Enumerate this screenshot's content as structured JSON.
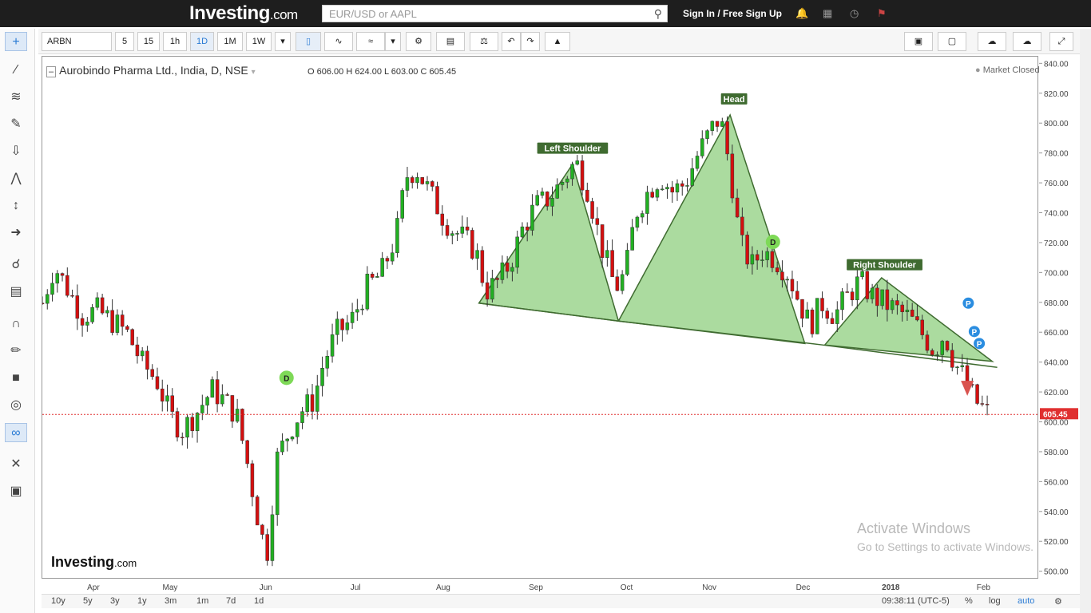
{
  "header": {
    "logo_main": "Investing",
    "logo_suffix": ".com",
    "search_placeholder": "EUR/USD or AAPL",
    "signin": "Sign In / Free Sign Up"
  },
  "toolbar": {
    "symbol": "ARBN",
    "intervals": [
      "5",
      "15",
      "1h",
      "1D",
      "1M",
      "1W"
    ],
    "active_interval": "1D"
  },
  "legend": {
    "title": "Aurobindo Pharma Ltd., India, D, NSE",
    "ohlc": "O 606.00  H 624.00  L 603.00  C 605.45",
    "market_status": "Market Closed"
  },
  "bottombar": {
    "ranges": [
      "10y",
      "5y",
      "3y",
      "1y",
      "3m",
      "1m",
      "7d",
      "1d"
    ],
    "time": "09:38:11 (UTC-5)",
    "percent": "%",
    "log": "log",
    "auto": "auto"
  },
  "watermark": {
    "main": "Investing",
    "suffix": ".com"
  },
  "os_notice": {
    "line1": "Activate Windows",
    "line2": "Go to Settings to activate Windows."
  },
  "colors": {
    "up": "#22b022",
    "down": "#d40f0f",
    "pattern_fill": "#8fcf7f",
    "pattern_line": "#3f6b30",
    "price_line": "#e03030",
    "accent": "#2a7bd4"
  },
  "chart_data": {
    "type": "candlestick",
    "ylim": [
      495,
      845
    ],
    "y_ticks": [
      500,
      520,
      540,
      560,
      580,
      600,
      620,
      640,
      660,
      680,
      700,
      720,
      740,
      760,
      780,
      800,
      820,
      840
    ],
    "x_ticks": [
      {
        "label": "Apr",
        "t": 0.052
      },
      {
        "label": "May",
        "t": 0.129
      },
      {
        "label": "Jun",
        "t": 0.225
      },
      {
        "label": "Jul",
        "t": 0.315
      },
      {
        "label": "Aug",
        "t": 0.403
      },
      {
        "label": "Sep",
        "t": 0.496
      },
      {
        "label": "Oct",
        "t": 0.587
      },
      {
        "label": "Nov",
        "t": 0.67
      },
      {
        "label": "Dec",
        "t": 0.764
      },
      {
        "label": "2018",
        "t": 0.852
      },
      {
        "label": "Feb",
        "t": 0.945
      }
    ],
    "close_series": [
      [
        0.0,
        680
      ],
      [
        0.012,
        705
      ],
      [
        0.025,
        690
      ],
      [
        0.04,
        672
      ],
      [
        0.055,
        675
      ],
      [
        0.07,
        668
      ],
      [
        0.085,
        660
      ],
      [
        0.1,
        640
      ],
      [
        0.115,
        628
      ],
      [
        0.128,
        605
      ],
      [
        0.14,
        595
      ],
      [
        0.155,
        607
      ],
      [
        0.17,
        622
      ],
      [
        0.182,
        615
      ],
      [
        0.195,
        605
      ],
      [
        0.205,
        575
      ],
      [
        0.215,
        540
      ],
      [
        0.225,
        510
      ],
      [
        0.235,
        575
      ],
      [
        0.248,
        595
      ],
      [
        0.26,
        608
      ],
      [
        0.272,
        615
      ],
      [
        0.282,
        640
      ],
      [
        0.295,
        660
      ],
      [
        0.31,
        668
      ],
      [
        0.325,
        690
      ],
      [
        0.34,
        700
      ],
      [
        0.355,
        725
      ],
      [
        0.365,
        765
      ],
      [
        0.375,
        770
      ],
      [
        0.388,
        755
      ],
      [
        0.4,
        740
      ],
      [
        0.41,
        730
      ],
      [
        0.42,
        725
      ],
      [
        0.435,
        715
      ],
      [
        0.445,
        688
      ],
      [
        0.458,
        695
      ],
      [
        0.47,
        708
      ],
      [
        0.482,
        730
      ],
      [
        0.495,
        745
      ],
      [
        0.508,
        750
      ],
      [
        0.52,
        760
      ],
      [
        0.535,
        775
      ],
      [
        0.548,
        755
      ],
      [
        0.56,
        720
      ],
      [
        0.575,
        690
      ],
      [
        0.585,
        700
      ],
      [
        0.595,
        740
      ],
      [
        0.608,
        755
      ],
      [
        0.62,
        765
      ],
      [
        0.632,
        755
      ],
      [
        0.645,
        760
      ],
      [
        0.658,
        780
      ],
      [
        0.67,
        795
      ],
      [
        0.68,
        805
      ],
      [
        0.69,
        770
      ],
      [
        0.7,
        720
      ],
      [
        0.712,
        705
      ],
      [
        0.722,
        715
      ],
      [
        0.735,
        710
      ],
      [
        0.748,
        700
      ],
      [
        0.76,
        680
      ],
      [
        0.77,
        665
      ],
      [
        0.782,
        680
      ],
      [
        0.795,
        672
      ],
      [
        0.808,
        685
      ],
      [
        0.82,
        695
      ],
      [
        0.832,
        685
      ],
      [
        0.845,
        680
      ],
      [
        0.858,
        675
      ],
      [
        0.87,
        670
      ],
      [
        0.882,
        660
      ],
      [
        0.895,
        648
      ],
      [
        0.905,
        660
      ],
      [
        0.915,
        640
      ],
      [
        0.925,
        630
      ],
      [
        0.935,
        615
      ],
      [
        0.95,
        605.45
      ]
    ],
    "pattern": {
      "neckline": [
        [
          0.438,
          680
        ],
        [
          0.578,
          668
        ],
        [
          0.783,
          652
        ],
        [
          0.955,
          640
        ]
      ],
      "labels": [
        "Left Shoulder",
        "Head",
        "Right Shoulder"
      ]
    },
    "markers": [
      {
        "label": "D",
        "t": 0.245,
        "y": 630
      },
      {
        "label": "D",
        "t": 0.733,
        "y": 721
      },
      {
        "label": "P",
        "t": 0.929,
        "y": 680
      },
      {
        "label": "P",
        "t": 0.935,
        "y": 661
      },
      {
        "label": "P",
        "t": 0.94,
        "y": 653
      }
    ],
    "last_price": "605.45",
    "last_price_value": 605.45
  }
}
